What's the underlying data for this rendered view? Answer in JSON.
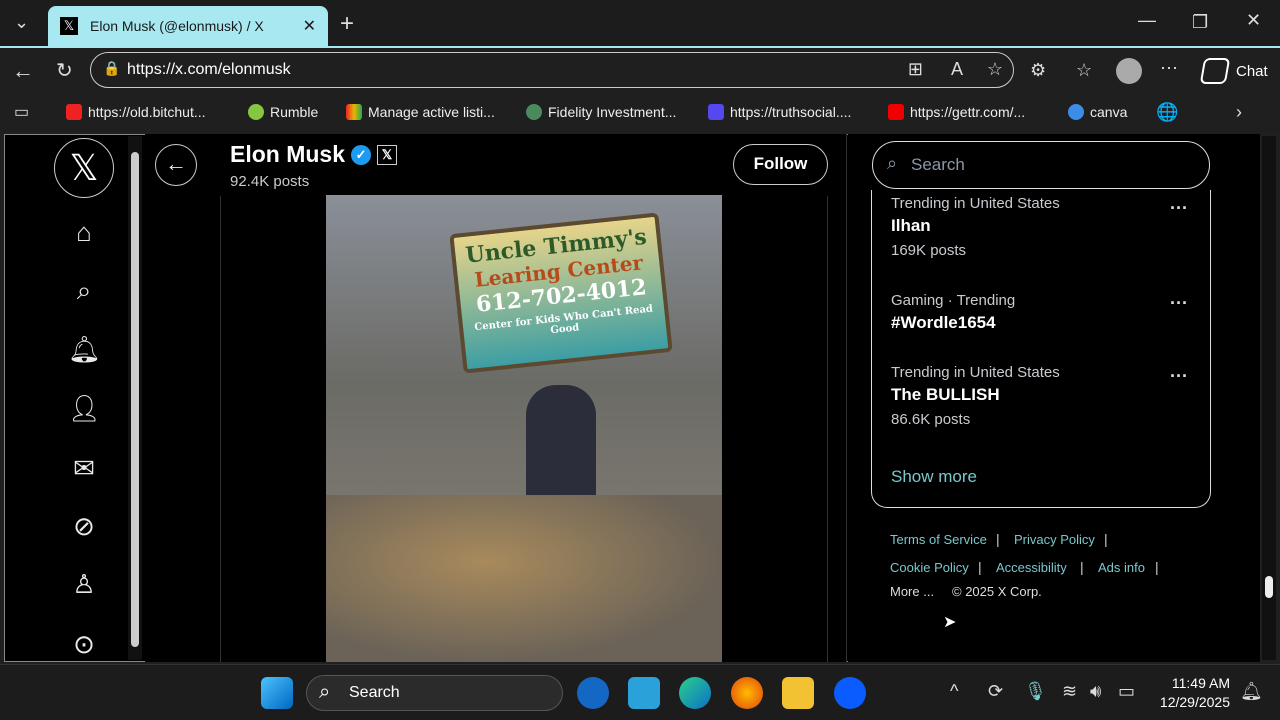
{
  "browser": {
    "tab_title": "Elon Musk (@elonmusk) / X",
    "url": "https://x.com/elonmusk",
    "chat_label": "Chat",
    "bookmarks": [
      {
        "label": "https://old.bitchut...",
        "color": "#e22"
      },
      {
        "label": "Rumble",
        "color": "#85c742"
      },
      {
        "label": "Manage active listi...",
        "color": "#e8b400"
      },
      {
        "label": "Fidelity Investment...",
        "color": "#4a8a5c"
      },
      {
        "label": "https://truthsocial....",
        "color": "#5448ee"
      },
      {
        "label": "https://gettr.com/...",
        "color": "#e00"
      },
      {
        "label": "canva",
        "color": "#3b8de8"
      }
    ]
  },
  "profile": {
    "name": "Elon Musk",
    "posts": "92.4K posts",
    "follow_label": "Follow"
  },
  "post_image": {
    "sign_line1": "Uncle Timmy's",
    "sign_line2": "Learing Center",
    "sign_phone": "612-702-4012",
    "sign_line3": "Center for Kids Who Can't Read Good"
  },
  "search": {
    "placeholder": "Search"
  },
  "trends": [
    {
      "context": "Trending in United States",
      "name": "Ilhan",
      "count": "169K posts"
    },
    {
      "context": "Gaming · Trending",
      "name": "#Wordle1654",
      "count": ""
    },
    {
      "context": "Trending in United States",
      "name": "The BULLISH",
      "count": "86.6K posts"
    }
  ],
  "show_more": "Show more",
  "footer": {
    "terms": "Terms of Service",
    "privacy": "Privacy Policy",
    "cookie": "Cookie Policy",
    "accessibility": "Accessibility",
    "ads": "Ads info",
    "more": "More ...",
    "copyright": "© 2025 X Corp."
  },
  "taskbar": {
    "search_label": "Search",
    "time": "11:49 AM",
    "date": "12/29/2025"
  }
}
